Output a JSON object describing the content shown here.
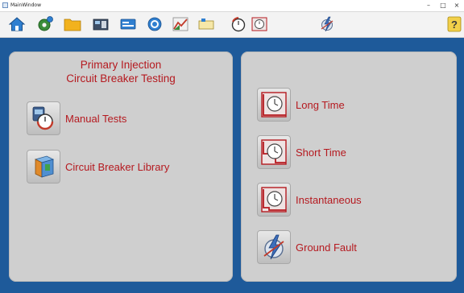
{
  "window": {
    "title": "MainWindow",
    "controls": {
      "minimize": "–",
      "maximize": "□",
      "close": "×"
    }
  },
  "toolbar": {
    "icons": [
      "home-icon",
      "settings-gear-icon",
      "folder-icon",
      "test-set-icon",
      "display-icon",
      "refresh-icon",
      "chart-icon",
      "ticket-icon",
      "stopwatch-icon",
      "clock-curve-icon",
      "lightning-icon",
      "help-icon"
    ],
    "help_label": "?"
  },
  "left_panel": {
    "heading_line1": "Primary Injection",
    "heading_line2": "Circuit Breaker Testing",
    "items": [
      {
        "label": "Manual Tests",
        "icon": "manual-tests-icon"
      },
      {
        "label": "Circuit Breaker Library",
        "icon": "breaker-library-icon"
      }
    ]
  },
  "right_panel": {
    "items": [
      {
        "label": "Long Time",
        "icon": "long-time-curve-icon"
      },
      {
        "label": "Short Time",
        "icon": "short-time-curve-icon"
      },
      {
        "label": "Instantaneous",
        "icon": "instantaneous-curve-icon"
      },
      {
        "label": "Ground Fault",
        "icon": "ground-fault-icon"
      }
    ]
  },
  "colors": {
    "accent_red": "#b5191f",
    "background_blue": "#1e5a9a",
    "panel_gray": "#cfcfcf"
  }
}
